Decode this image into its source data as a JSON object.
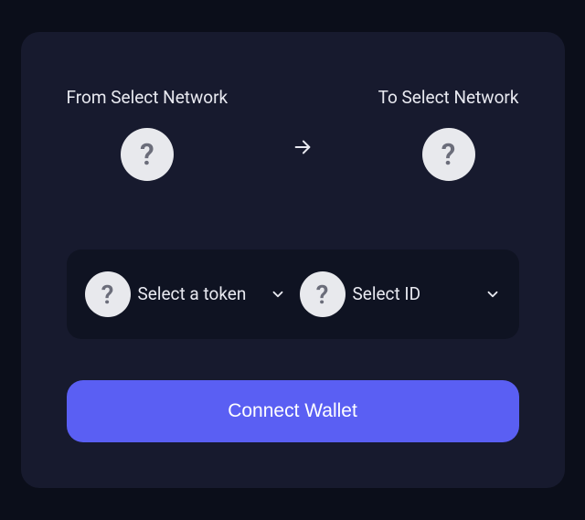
{
  "networks": {
    "from_label": "From Select Network",
    "to_label": "To Select Network"
  },
  "selectors": {
    "token_label": "Select a token",
    "id_label": "Select ID"
  },
  "button": {
    "connect_label": "Connect Wallet"
  }
}
